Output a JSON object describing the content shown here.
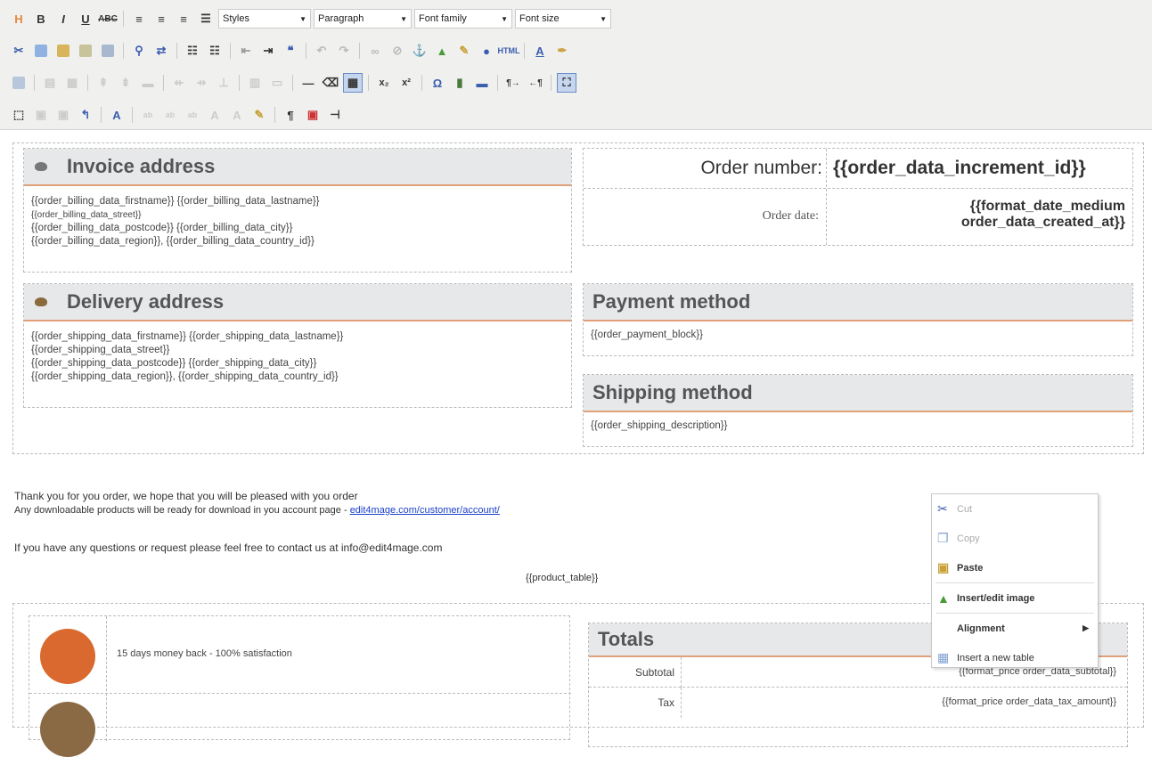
{
  "toolbar": {
    "row1": {
      "styles": "Styles",
      "format": "Paragraph",
      "font_family": "Font family",
      "font_size": "Font size"
    }
  },
  "invoice": {
    "title": "Invoice address",
    "lines": [
      "{{order_billing_data_firstname}} {{order_billing_data_lastname}}",
      "{{order_billing_data_street}}",
      "{{order_billing_data_postcode}} {{order_billing_data_city}}",
      "{{order_billing_data_region}}, {{order_billing_data_country_id}}"
    ]
  },
  "order": {
    "number_label": "Order number:",
    "number_value": "{{order_data_increment_id}}",
    "date_label": "Order date:",
    "date_value_1": "{{format_date_medium",
    "date_value_2": "order_data_created_at}}"
  },
  "delivery": {
    "title": "Delivery address",
    "lines": [
      "{{order_shipping_data_firstname}} {{order_shipping_data_lastname}}",
      "{{order_shipping_data_street}}",
      "{{order_shipping_data_postcode}} {{order_shipping_data_city}}",
      "{{order_shipping_data_region}}, {{order_shipping_data_country_id}}"
    ]
  },
  "payment": {
    "title": "Payment method",
    "value": "{{order_payment_block}}"
  },
  "shipping": {
    "title": "Shipping method",
    "value": "{{order_shipping_description}}"
  },
  "message": {
    "line1": "Thank you for you order, we hope that you will be pleased with you order",
    "line2_prefix": "Any downloadable products will be ready for download in you account page - ",
    "line2_link": "edit4mage.com/customer/account/",
    "line3": "If you have any questions or request please feel free to contact us at info@edit4mage.com",
    "product_table": "{{product_table}}"
  },
  "guarantee": {
    "text1": "15 days money back - 100% satisfaction"
  },
  "totals": {
    "title": "Totals",
    "rows": [
      {
        "label": "Subtotal",
        "value": "{{format_price order_data_subtotal}}"
      },
      {
        "label": "Tax",
        "value": "{{format_price order_data_tax_amount}}"
      }
    ]
  },
  "context_menu": {
    "cut": "Cut",
    "copy": "Copy",
    "paste": "Paste",
    "insert_image": "Insert/edit image",
    "alignment": "Alignment",
    "insert_table": "Insert a new table"
  },
  "colors": {
    "accent_underline": "#e0a07a",
    "header_bg": "#e6e8ea",
    "link": "#1a3fc9",
    "badge_orange": "#d9692e",
    "badge_brown": "#8a6a45"
  }
}
